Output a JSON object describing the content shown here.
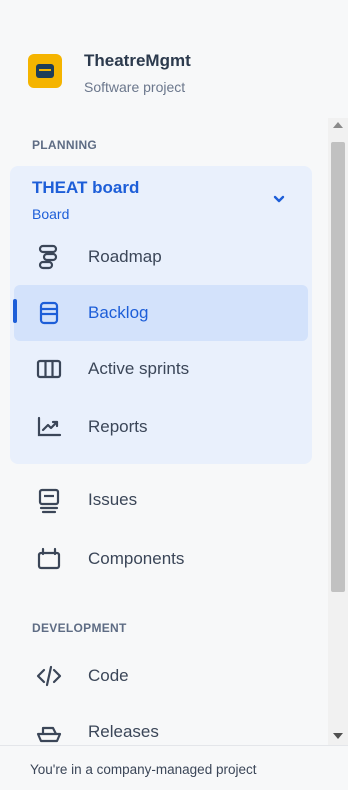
{
  "project": {
    "name": "TheatreMgmt",
    "type": "Software project"
  },
  "sections": {
    "planning": "PLANNING",
    "development": "DEVELOPMENT"
  },
  "board": {
    "title": "THEAT board",
    "subtitle": "Board"
  },
  "nav": {
    "roadmap": "Roadmap",
    "backlog": "Backlog",
    "active_sprints": "Active sprints",
    "reports": "Reports",
    "issues": "Issues",
    "components": "Components",
    "code": "Code",
    "releases": "Releases"
  },
  "footer": {
    "text": "You're in a company-managed project"
  },
  "colors": {
    "accent": "#1d5ed8",
    "active_bg": "#d3e2fb",
    "group_bg": "#e9f0fc",
    "avatar": "#f5b400"
  }
}
